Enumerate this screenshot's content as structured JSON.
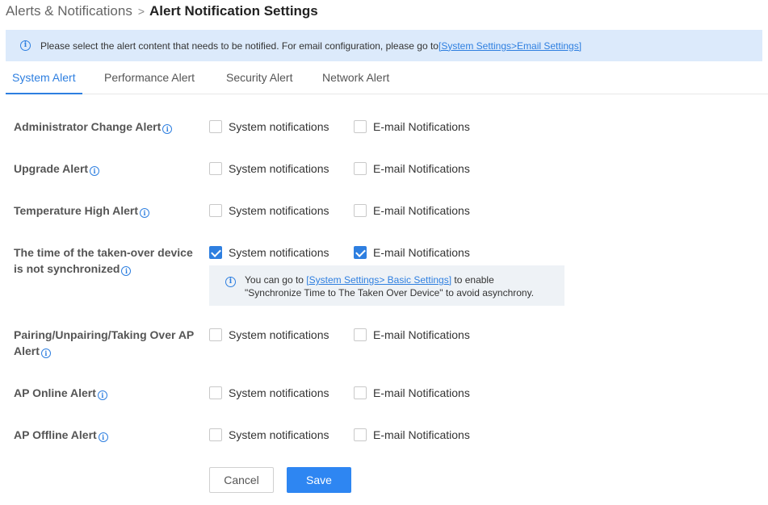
{
  "breadcrumb": {
    "parent": "Alerts & Notifications",
    "separator": ">",
    "current": "Alert Notification Settings"
  },
  "info_banner": {
    "text": "Please select the alert content that needs to be notified. For email configuration, please go to ",
    "link": "[System Settings>Email Settings]",
    "icon": "info-icon"
  },
  "tabs": [
    {
      "label": "System Alert",
      "active": true
    },
    {
      "label": "Performance Alert",
      "active": false
    },
    {
      "label": "Security Alert",
      "active": false
    },
    {
      "label": "Network Alert",
      "active": false
    }
  ],
  "option_labels": {
    "system": "System notifications",
    "email": "E-mail Notifications"
  },
  "alerts": [
    {
      "label_lines": [
        "Administrator Change Alert"
      ],
      "system": false,
      "email": false
    },
    {
      "label_lines": [
        "Upgrade Alert"
      ],
      "system": false,
      "email": false
    },
    {
      "label_lines": [
        "Temperature High Alert"
      ],
      "system": false,
      "email": false
    },
    {
      "label_lines": [
        "The time of the taken-over device",
        "is not synchronized"
      ],
      "system": true,
      "email": true
    },
    {
      "label_lines": [
        "Pairing/Unpairing/Taking Over AP",
        "Alert"
      ],
      "system": false,
      "email": false
    },
    {
      "label_lines": [
        "AP Online Alert"
      ],
      "system": false,
      "email": false
    },
    {
      "label_lines": [
        "AP Offline Alert"
      ],
      "system": false,
      "email": false
    }
  ],
  "sync_note": {
    "prefix": "You can go to ",
    "link": "[System Settings> Basic Settings]",
    "suffix": " to enable",
    "line2": "\"Synchronize Time to The Taken Over Device\" to avoid asynchrony."
  },
  "buttons": {
    "cancel": "Cancel",
    "save": "Save"
  },
  "colors": {
    "accent": "#2e7fe0",
    "banner_bg": "#dceafb",
    "note_bg": "#eef2f6",
    "save_bg": "#2e86f2"
  }
}
